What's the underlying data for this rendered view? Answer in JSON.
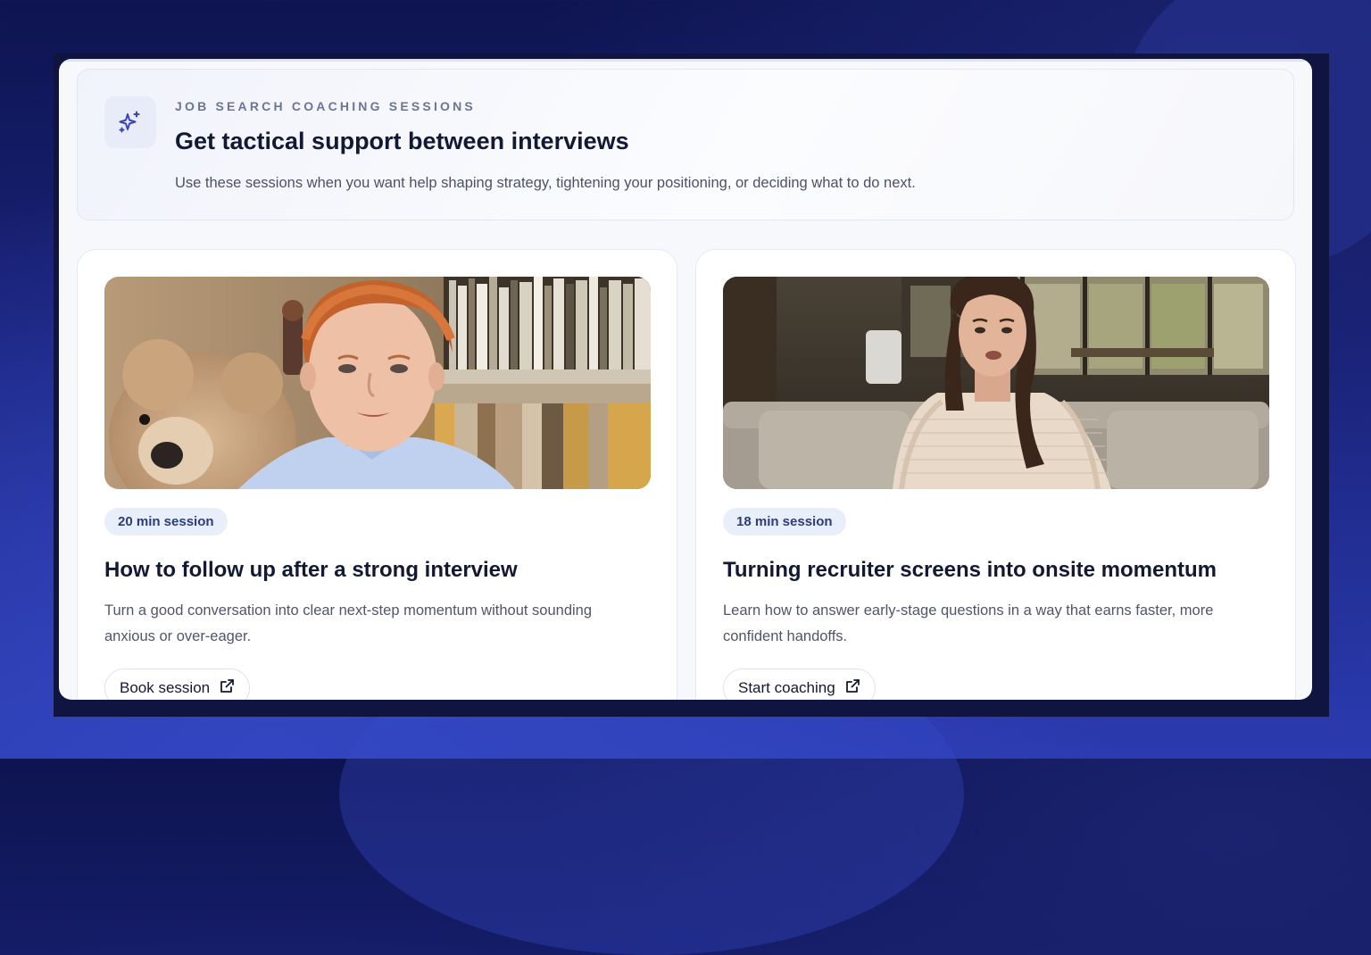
{
  "hero": {
    "icon": "sparkles-icon",
    "eyebrow": "JOB SEARCH COACHING SESSIONS",
    "title": "Get tactical support between interviews",
    "description": "Use these sessions when you want help shaping strategy, tightening your positioning, or deciding what to do next."
  },
  "cards": [
    {
      "badge": "20 min session",
      "title": "How to follow up after a strong interview",
      "description": "Turn a good conversation into clear next-step momentum without sounding anxious or over-eager.",
      "button_label": "Book session",
      "button_icon": "external-link-icon"
    },
    {
      "badge": "18 min session",
      "title": "Turning recruiter screens into onsite momentum",
      "description": "Learn how to answer early-stage questions in a way that earns faster, more confident handoffs.",
      "button_label": "Start coaching",
      "button_icon": "external-link-icon"
    }
  ],
  "colors": {
    "accent": "#3b43b8",
    "badge_bg": "#e9eefb",
    "badge_text": "#2c3e7a",
    "title_text": "#111935"
  }
}
